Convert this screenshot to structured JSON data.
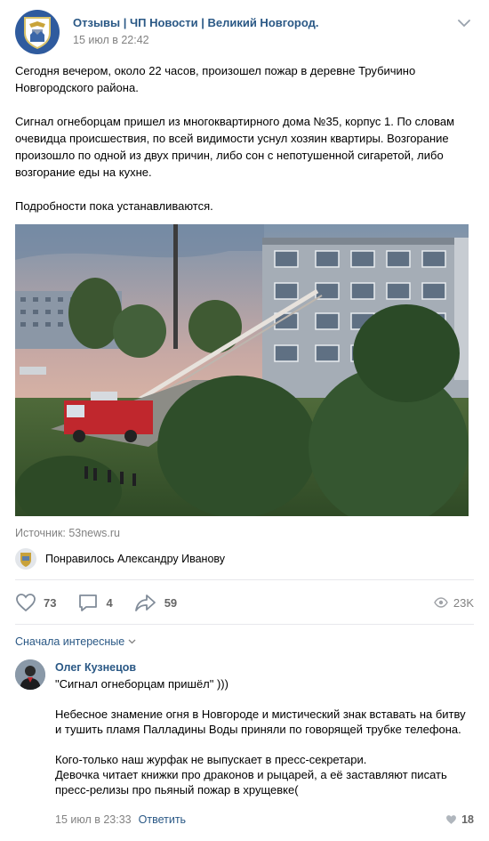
{
  "post": {
    "group_name": "Отзывы | ЧП Новости | Великий Новгород.",
    "date": "15 июл в 22:42",
    "paragraphs": [
      "Сегодня вечером, около 22 часов, произошел пожар в деревне Трубичино Новгородского района.",
      "Сигнал огнеборцам пришел из многоквартирного дома №35, корпус 1. По словам очевидца происшествия, по всей видимости уснул хозяин квартиры. Возгорание произошло по одной из двух причин, либо сон с непотушенной сигаретой, либо возгорание еды на кухне.",
      "Подробности пока устанавливаются."
    ],
    "source_label": "Источник:",
    "source_link": "53news.ru",
    "liked_by": "Понравилось Александру Иванову"
  },
  "actions": {
    "likes": "73",
    "comments": "4",
    "shares": "59",
    "views": "23K"
  },
  "comments_section": {
    "sort_label": "Сначала интересные"
  },
  "comment": {
    "author": "Олег Кузнецов",
    "paragraphs": [
      "\"Сигнал огнеборцам пришёл\" )))",
      "Небесное знамение огня в Новгороде и мистический знак вставать на битву и тушить пламя Палладины Воды приняли по говорящей трубке телефона.",
      "Кого-только наш журфак не выпускает в пресс-секретари.\nДевочка читает книжки про драконов и рыцарей, а её заставляют писать пресс-релизы про пьяный пожар в хрущевке("
    ],
    "date": "15 июл в 23:33",
    "reply": "Ответить",
    "likes": "18"
  },
  "colors": {
    "link": "#2a5885",
    "muted": "#828282",
    "divider": "#e7e8ec"
  },
  "icons": [
    "group-emblem-icon",
    "chevron-down-icon",
    "heart-icon",
    "comment-icon",
    "share-icon",
    "eye-icon"
  ]
}
